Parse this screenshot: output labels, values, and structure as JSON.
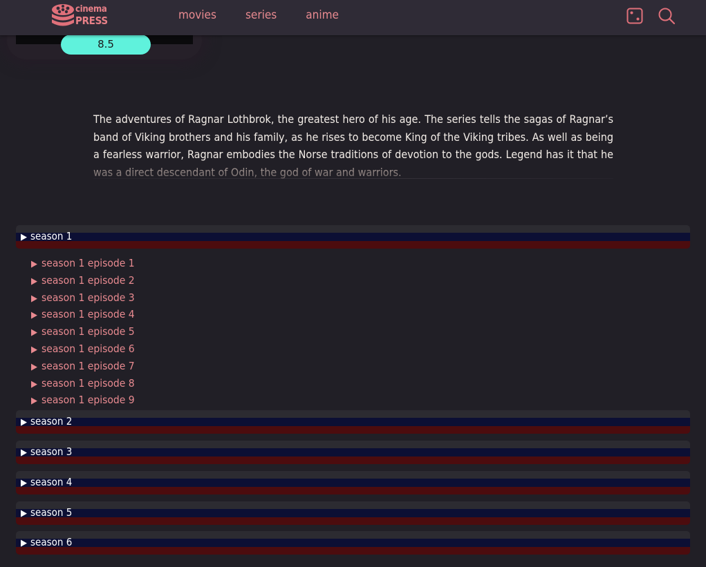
{
  "header": {
    "logo": {
      "line1": "cinema",
      "line2": "PRESS"
    },
    "nav": [
      {
        "label": "movies"
      },
      {
        "label": "series"
      },
      {
        "label": "anime"
      }
    ],
    "icons": {
      "random": "dice-icon",
      "search": "search-icon"
    }
  },
  "rating": {
    "value": "8.5"
  },
  "description": {
    "text": "The adventures of Ragnar Lothbrok, the greatest hero of his age. The series tells the sagas of Ragnar’s band of Viking brothers and his family, as he rises to become King of the Viking tribes. As well as being a fearless warrior, Ragnar embodies the Norse traditions of devotion to the gods. Legend has it that he",
    "fade_text": "was a direct descendant of Odin, the god of war and warriors."
  },
  "seasons": [
    {
      "label": "season 1",
      "expanded": true,
      "episodes": [
        "season 1 episode 1",
        "season 1 episode 2",
        "season 1 episode 3",
        "season 1 episode 4",
        "season 1 episode 5",
        "season 1 episode 6",
        "season 1 episode 7",
        "season 1 episode 8",
        "season 1 episode 9"
      ]
    },
    {
      "label": "season 2",
      "expanded": false
    },
    {
      "label": "season 3",
      "expanded": false
    },
    {
      "label": "season 4",
      "expanded": false
    },
    {
      "label": "season 5",
      "expanded": false
    },
    {
      "label": "season 6",
      "expanded": false
    }
  ],
  "colors": {
    "background": "#211f26",
    "header": "#2f2b36",
    "accent": "#e88a90",
    "rating": "#5ff2dc"
  }
}
